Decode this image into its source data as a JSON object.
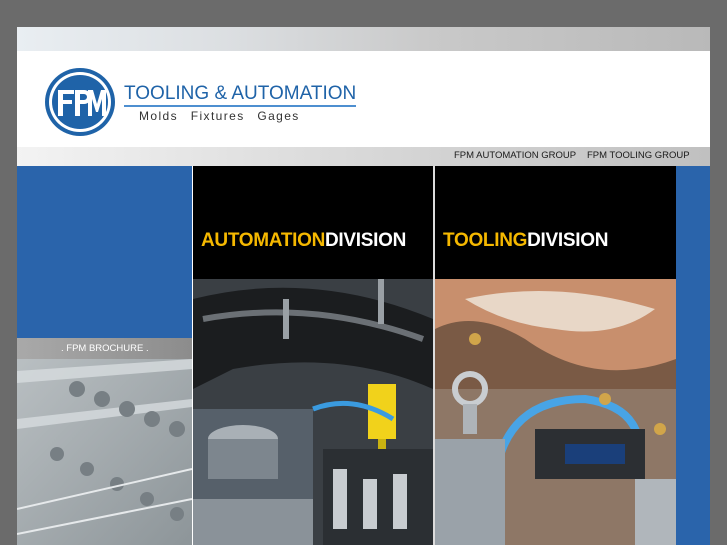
{
  "brand": {
    "title": "TOOLING & AUTOMATION",
    "subtitle": "Molds  Fixtures  Gages",
    "colors": {
      "blue": "#2a64ab",
      "accent": "#f5b800"
    }
  },
  "nav": {
    "items": [
      {
        "label": "FPM AUTOMATION GROUP"
      },
      {
        "label": "FPM TOOLING GROUP"
      }
    ]
  },
  "sidebar": {
    "brochure_label": ". FPM BROCHURE ."
  },
  "panels": [
    {
      "word1": "AUTOMATION",
      "word2": "DIVISION"
    },
    {
      "word1": "TOOLING",
      "word2": "DIVISION"
    }
  ]
}
